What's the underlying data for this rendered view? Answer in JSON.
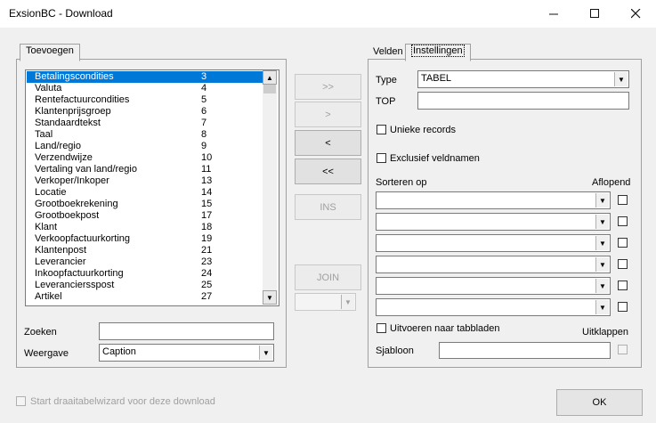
{
  "window": {
    "title": "ExsionBC - Download",
    "minimize_icon": "minimize-icon",
    "maximize_icon": "maximize-icon",
    "close_icon": "close-icon"
  },
  "left_panel": {
    "tab_label": "Toevoegen",
    "list_items": [
      {
        "label": "Betalingscondities",
        "num": "3"
      },
      {
        "label": "Valuta",
        "num": "4"
      },
      {
        "label": "Rentefactuurcondities",
        "num": "5"
      },
      {
        "label": "Klantenprijsgroep",
        "num": "6"
      },
      {
        "label": "Standaardtekst",
        "num": "7"
      },
      {
        "label": "Taal",
        "num": "8"
      },
      {
        "label": "Land/regio",
        "num": "9"
      },
      {
        "label": "Verzendwijze",
        "num": "10"
      },
      {
        "label": "Vertaling van land/regio",
        "num": "11"
      },
      {
        "label": "Verkoper/Inkoper",
        "num": "13"
      },
      {
        "label": "Locatie",
        "num": "14"
      },
      {
        "label": "Grootboekrekening",
        "num": "15"
      },
      {
        "label": "Grootboekpost",
        "num": "17"
      },
      {
        "label": "Klant",
        "num": "18"
      },
      {
        "label": "Verkoopfactuurkorting",
        "num": "19"
      },
      {
        "label": "Klantenpost",
        "num": "21"
      },
      {
        "label": "Leverancier",
        "num": "23"
      },
      {
        "label": "Inkoopfactuurkorting",
        "num": "24"
      },
      {
        "label": "Leveranciersspost",
        "num": "25"
      },
      {
        "label": "Artikel",
        "num": "27"
      }
    ],
    "zoeken_label": "Zoeken",
    "zoeken_value": "",
    "weergave_label": "Weergave",
    "weergave_value": "Caption"
  },
  "middle": {
    "add_all": ">>",
    "add_one": ">",
    "remove_one": "<",
    "remove_all": "<<",
    "ins": "INS",
    "join": "JOIN",
    "join_select_value": ""
  },
  "right_panel": {
    "tab_velden": "Velden",
    "tab_instellingen": "Instellingen",
    "type_label": "Type",
    "type_value": "TABEL",
    "top_label": "TOP",
    "top_value": "",
    "unieke_records": "Unieke records",
    "exclusief_veldnamen": "Exclusief veldnamen",
    "sorteren_op": "Sorteren op",
    "aflopend": "Aflopend",
    "sort_values": [
      "",
      "",
      "",
      "",
      "",
      ""
    ],
    "uitvoeren_naar_tabbladen": "Uitvoeren naar tabbladen",
    "uitklappen": "Uitklappen",
    "sjabloon_label": "Sjabloon",
    "sjabloon_value": ""
  },
  "footer": {
    "pivot_wizard": "Start draaitabelwizard voor deze download",
    "ok": "OK"
  }
}
